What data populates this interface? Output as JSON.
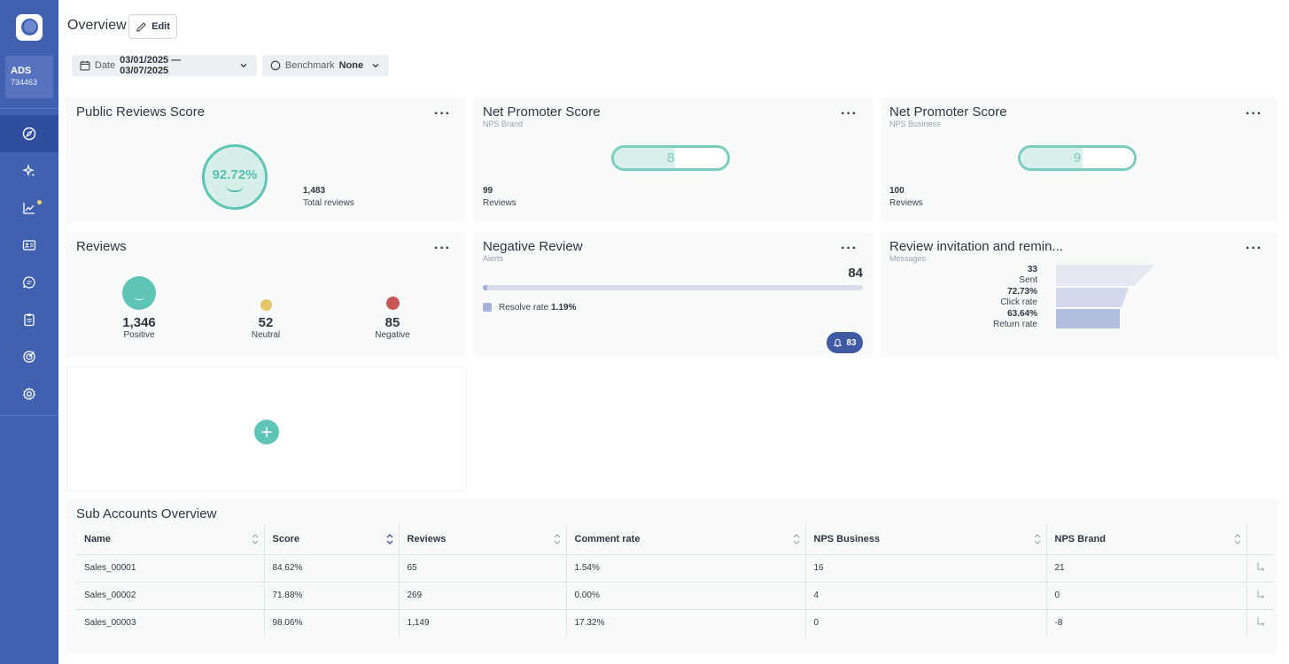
{
  "sidebar": {
    "account": {
      "name": "ADS",
      "id": "734463"
    },
    "icons": [
      "compass-icon",
      "sparkle-icon",
      "trend-chart-icon",
      "id-card-icon",
      "chat-icon",
      "clipboard-icon",
      "target-icon",
      "gear-icon"
    ],
    "active_item": "compass-icon",
    "notification_dot_color": "#f3d26a"
  },
  "header": {
    "title": "Overview",
    "edit_label": "Edit",
    "date_filter": {
      "label": "Date",
      "value": "03/01/2025 — 03/07/2025"
    },
    "benchmark_filter": {
      "label": "Benchmark",
      "value": "None"
    }
  },
  "cards": {
    "public_reviews": {
      "title": "Public Reviews Score",
      "score": "92.72%",
      "total_value": "1,483",
      "total_label": "Total reviews"
    },
    "nps_brand": {
      "title": "Net Promoter Score",
      "subtitle": "NPS Brand",
      "value": "8",
      "reviews_value": "99",
      "reviews_label": "Reviews"
    },
    "nps_business": {
      "title": "Net Promoter Score",
      "subtitle": "NPS Business",
      "value": "9",
      "reviews_value": "100",
      "reviews_label": "Reviews"
    },
    "reviews": {
      "title": "Reviews",
      "positive": {
        "value": "1,346",
        "label": "Positive",
        "color": "#5ec4b6"
      },
      "neutral": {
        "value": "52",
        "label": "Neutral",
        "color": "#e3c56a"
      },
      "negative": {
        "value": "85",
        "label": "Negative",
        "color": "#c95656"
      }
    },
    "negative_review": {
      "title": "Negative Review",
      "subtitle": "Alerts",
      "count": "84",
      "legend_label": "Resolve rate",
      "resolve_rate": "1.19%",
      "resolve_fraction": 0.0119,
      "alerts_badge": "83"
    },
    "invitations": {
      "title": "Review invitation and remin...",
      "subtitle": "Messages",
      "funnel": [
        {
          "value": "33",
          "label": "Sent"
        },
        {
          "value": "72.73%",
          "label": "Click rate"
        },
        {
          "value": "63.64%",
          "label": "Return rate"
        }
      ]
    }
  },
  "sub_accounts": {
    "title": "Sub Accounts Overview",
    "columns": [
      "Name",
      "Score",
      "Reviews",
      "Comment rate",
      "NPS Business",
      "NPS Brand"
    ],
    "rows": [
      [
        "Sales_00001",
        "84.62%",
        "65",
        "1.54%",
        "16",
        "21"
      ],
      [
        "Sales_00002",
        "71.88%",
        "269",
        "0.00%",
        "4",
        "0"
      ],
      [
        "Sales_00003",
        "98.06%",
        "1,149",
        "17.32%",
        "0",
        "-8"
      ]
    ]
  }
}
